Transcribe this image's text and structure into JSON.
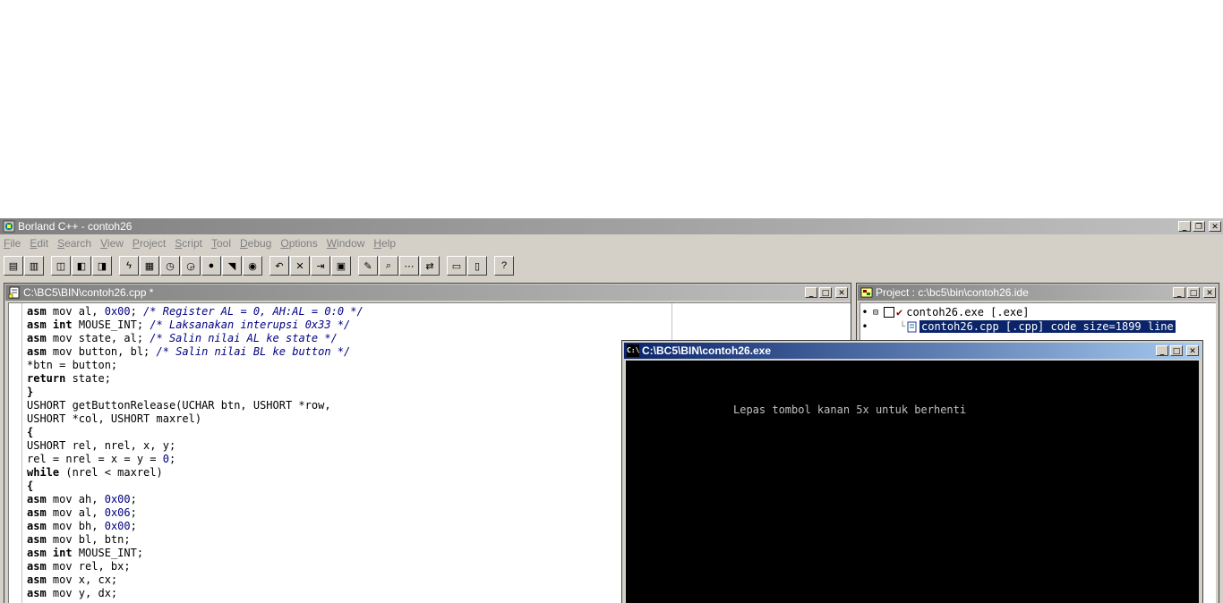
{
  "app": {
    "title": "Borland C++ - contoh26",
    "menu": [
      {
        "label": "File",
        "accel": "F",
        "rest": "ile"
      },
      {
        "label": "Edit",
        "accel": "E",
        "rest": "dit"
      },
      {
        "label": "Search",
        "accel": "S",
        "rest": "earch"
      },
      {
        "label": "View",
        "accel": "V",
        "rest": "iew"
      },
      {
        "label": "Project",
        "accel": "P",
        "rest": "roject"
      },
      {
        "label": "Script",
        "accel": "S",
        "rest": "cript"
      },
      {
        "label": "Tool",
        "accel": "T",
        "rest": "ool"
      },
      {
        "label": "Debug",
        "accel": "D",
        "rest": "ebug"
      },
      {
        "label": "Options",
        "accel": "O",
        "rest": "ptions"
      },
      {
        "label": "Window",
        "accel": "W",
        "rest": "indow"
      },
      {
        "label": "Help",
        "accel": "H",
        "rest": "elp"
      }
    ],
    "toolbar_icons": [
      "open-file-icon",
      "save-file-icon",
      "view-browse-icon",
      "view-project-icon",
      "view-message-icon",
      "make-icon",
      "compile-icon",
      "run-icon",
      "step-icon",
      "breakpoint-icon",
      "inspect-icon",
      "watch-icon",
      "undo-icon",
      "cut-icon",
      "copy-icon",
      "paste-icon",
      "highlight-icon",
      "search-icon",
      "search-next-icon",
      "replace-icon",
      "window-tile-icon",
      "window-cascade-icon",
      "help-icon"
    ]
  },
  "editor": {
    "title": "C:\\BC5\\BIN\\contoh26.cpp *",
    "lines": [
      [
        {
          "t": "asm",
          "c": "kw"
        },
        {
          "t": " mov al, "
        },
        {
          "t": "0x00",
          "c": "num"
        },
        {
          "t": "; "
        },
        {
          "t": "/* Register AL = 0, AH:AL = 0:0 */",
          "c": "cmt"
        }
      ],
      [
        {
          "t": "asm",
          "c": "kw"
        },
        {
          "t": " "
        },
        {
          "t": "int",
          "c": "kw"
        },
        {
          "t": " MOUSE_INT; "
        },
        {
          "t": "/* Laksanakan interupsi 0x33 */",
          "c": "cmt"
        }
      ],
      [
        {
          "t": "asm",
          "c": "kw"
        },
        {
          "t": " mov state, al; "
        },
        {
          "t": "/* Salin nilai AL ke state */",
          "c": "cmt"
        }
      ],
      [
        {
          "t": "asm",
          "c": "kw"
        },
        {
          "t": " mov button, bl; "
        },
        {
          "t": "/* Salin nilai BL ke button */",
          "c": "cmt"
        }
      ],
      [
        {
          "t": "*btn = button;"
        }
      ],
      [
        {
          "t": "return",
          "c": "kw"
        },
        {
          "t": " state;"
        }
      ],
      [
        {
          "t": "}",
          "c": "kw"
        }
      ],
      [
        {
          "t": "USHORT getButtonRelease(UCHAR btn, USHORT *row,"
        }
      ],
      [
        {
          "t": "USHORT *col, USHORT maxrel)"
        }
      ],
      [
        {
          "t": "{",
          "c": "kw"
        }
      ],
      [
        {
          "t": "USHORT rel, nrel, x, y;"
        }
      ],
      [
        {
          "t": "rel = nrel = x = y = "
        },
        {
          "t": "0",
          "c": "num"
        },
        {
          "t": ";"
        }
      ],
      [
        {
          "t": "while",
          "c": "kw"
        },
        {
          "t": " (nrel < maxrel)"
        }
      ],
      [
        {
          "t": "{",
          "c": "kw"
        }
      ],
      [
        {
          "t": "asm",
          "c": "kw"
        },
        {
          "t": " mov ah, "
        },
        {
          "t": "0x00",
          "c": "num"
        },
        {
          "t": ";"
        }
      ],
      [
        {
          "t": "asm",
          "c": "kw"
        },
        {
          "t": " mov al, "
        },
        {
          "t": "0x06",
          "c": "num"
        },
        {
          "t": ";"
        }
      ],
      [
        {
          "t": "asm",
          "c": "kw"
        },
        {
          "t": " mov bh, "
        },
        {
          "t": "0x00",
          "c": "num"
        },
        {
          "t": ";"
        }
      ],
      [
        {
          "t": "asm",
          "c": "kw"
        },
        {
          "t": " mov bl, btn;"
        }
      ],
      [
        {
          "t": "asm",
          "c": "kw"
        },
        {
          "t": " "
        },
        {
          "t": "int",
          "c": "kw"
        },
        {
          "t": " MOUSE_INT;"
        }
      ],
      [
        {
          "t": "asm",
          "c": "kw"
        },
        {
          "t": " mov rel, bx;"
        }
      ],
      [
        {
          "t": "asm",
          "c": "kw"
        },
        {
          "t": " mov x, cx;"
        }
      ],
      [
        {
          "t": "asm",
          "c": "kw"
        },
        {
          "t": " mov y, dx;"
        }
      ]
    ]
  },
  "project": {
    "title": "Project : c:\\bc5\\bin\\contoh26.ide",
    "items": [
      {
        "label": "contoh26.exe [.exe]"
      },
      {
        "label": "contoh26.cpp [.cpp]  code size=1899  line"
      }
    ]
  },
  "console": {
    "title": "C:\\BC5\\BIN\\contoh26.exe",
    "output": "Lepas tombol kanan 5x untuk berhenti"
  },
  "colors": {
    "face": "#d4d0c8",
    "active_caption": "#0a246a",
    "inactive_caption": "#808080",
    "code_comment": "#000080"
  }
}
